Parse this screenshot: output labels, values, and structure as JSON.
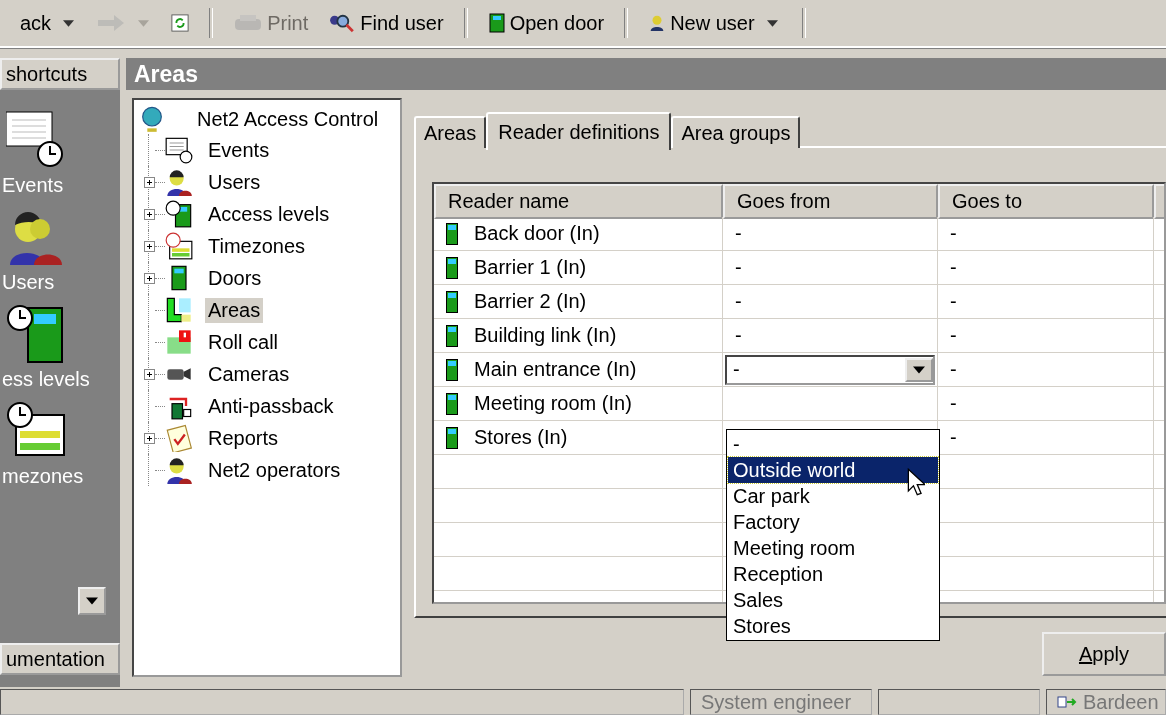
{
  "toolbar": [
    {
      "kind": "button",
      "label": "ack",
      "disabled": false,
      "dropdown": true
    },
    {
      "kind": "button",
      "disabled": true,
      "dropdown": true
    },
    {
      "kind": "button",
      "disabled": false
    },
    {
      "kind": "separator"
    },
    {
      "kind": "button",
      "label": "Print",
      "disabled": true
    },
    {
      "kind": "button",
      "label": "Find user",
      "disabled": false
    },
    {
      "kind": "separator"
    },
    {
      "kind": "button",
      "label": "Open door",
      "disabled": false
    },
    {
      "kind": "separator"
    },
    {
      "kind": "button",
      "label": "New user",
      "disabled": false,
      "dropdown": true
    },
    {
      "kind": "separator"
    }
  ],
  "shortcuts": {
    "title": "shortcuts",
    "items": [
      {
        "label": "Events"
      },
      {
        "label": "Users"
      },
      {
        "label": "ess levels"
      },
      {
        "label": "mezones"
      }
    ],
    "footer": "umentation"
  },
  "header": {
    "title": "Areas"
  },
  "tree": {
    "root": "Net2 Access Control",
    "children": [
      {
        "label": "Events",
        "expandable": false,
        "selected": false
      },
      {
        "label": "Users",
        "expandable": true,
        "selected": false
      },
      {
        "label": "Access levels",
        "expandable": true,
        "selected": false
      },
      {
        "label": "Timezones",
        "expandable": true,
        "selected": false
      },
      {
        "label": "Doors",
        "expandable": true,
        "selected": false
      },
      {
        "label": "Areas",
        "expandable": false,
        "selected": true
      },
      {
        "label": "Roll call",
        "expandable": false,
        "selected": false
      },
      {
        "label": "Cameras",
        "expandable": true,
        "selected": false
      },
      {
        "label": "Anti-passback",
        "expandable": false,
        "selected": false
      },
      {
        "label": "Reports",
        "expandable": true,
        "selected": false
      },
      {
        "label": "Net2 operators",
        "expandable": false,
        "selected": false
      }
    ]
  },
  "tabs": [
    {
      "label": "Areas",
      "selected": false
    },
    {
      "label": "Reader definitions",
      "selected": true
    },
    {
      "label": "Area groups",
      "selected": false
    }
  ],
  "table": {
    "columns": [
      "Reader name",
      "Goes from",
      "Goes to"
    ],
    "rows": [
      {
        "name": "Back door (In)",
        "from": "-",
        "to": "-",
        "editing": false
      },
      {
        "name": "Barrier 1 (In)",
        "from": "-",
        "to": "-",
        "editing": false
      },
      {
        "name": "Barrier 2 (In)",
        "from": "-",
        "to": "-",
        "editing": false
      },
      {
        "name": "Building link (In)",
        "from": "-",
        "to": "-",
        "editing": false
      },
      {
        "name": "Main entrance (In)",
        "from": "-",
        "to": "-",
        "editing": true
      },
      {
        "name": "Meeting room (In)",
        "to": "-",
        "editing": false
      },
      {
        "name": "Stores (In)",
        "to": "-",
        "editing": false
      }
    ]
  },
  "dropdown_list": [
    {
      "label": "-",
      "selected": false
    },
    {
      "label": "Outside world",
      "selected": true
    },
    {
      "label": "Car park",
      "selected": false
    },
    {
      "label": "Factory",
      "selected": false
    },
    {
      "label": "Meeting room",
      "selected": false
    },
    {
      "label": "Reception",
      "selected": false
    },
    {
      "label": "Sales",
      "selected": false
    },
    {
      "label": "Stores",
      "selected": false
    }
  ],
  "apply_button": "Apply",
  "status_bar": {
    "operator": "System engineer",
    "user": "Bardeen"
  }
}
